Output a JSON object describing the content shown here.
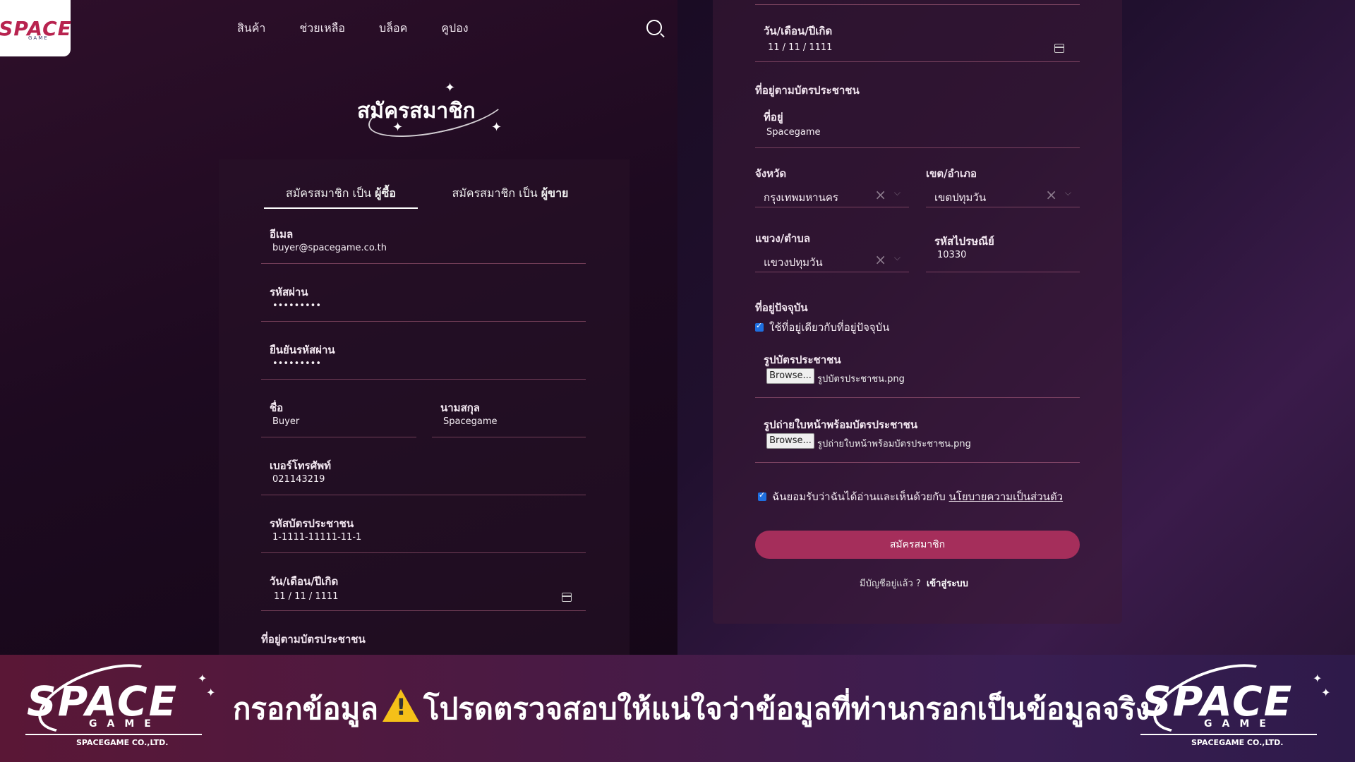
{
  "brand": {
    "logo": "SPACE",
    "logo_sub": "GAME"
  },
  "nav": {
    "items": [
      "สินค้า",
      "ช่วยเหลือ",
      "บล็อค",
      "คูปอง"
    ]
  },
  "page_title": "สมัครสมาชิก",
  "tabs": {
    "buyer_prefix": "สมัครสมาชิก เป็น ",
    "buyer_bold": "ผู้ซื้อ",
    "seller_prefix": "สมัครสมาชิก เป็น ",
    "seller_bold": "ผู้ขาย"
  },
  "left_form": {
    "email_label": "อีเมล",
    "email_value": "buyer@spacegame.co.th",
    "password_label": "รหัสผ่าน",
    "password_value": "•••••••••",
    "confirm_label": "ยืนยันรหัสผ่าน",
    "confirm_value": "•••••••••",
    "firstname_label": "ชื่อ",
    "firstname_value": "Buyer",
    "lastname_label": "นามสกุล",
    "lastname_value": "Spacegame",
    "phone_label": "เบอร์โทรศัพท์",
    "phone_value": "021143219",
    "idcard_label": "รหัสบัตรประชาชน",
    "idcard_value": "1-1111-11111-11-1",
    "dob_label": "วัน/เดือน/ปีเกิด",
    "dob_value": "11 / 11 / 1111",
    "address_section": "ที่อยู่ตามบัตรประชาชน"
  },
  "right_form": {
    "dob_label": "วัน/เดือน/ปีเกิด",
    "dob_value": "11 / 11 / 1111",
    "address_section": "ที่อยู่ตามบัตรประชาชน",
    "address_label": "ที่อยู่",
    "address_value": "Spacegame",
    "province_label": "จังหวัด",
    "province_value": "กรุงเทพมหานคร",
    "district_label": "เขต/อำเภอ",
    "district_value": "เขตปทุมวัน",
    "subdistrict_label": "แขวง/ตำบล",
    "subdistrict_value": "แขวงปทุมวัน",
    "postal_label": "รหัสไปรษณีย์",
    "postal_value": "10330",
    "current_address_section": "ที่อยู่ปัจจุบัน",
    "same_address_label": "ใช้ที่อยู่เดียวกับที่อยู่ปัจจุบัน",
    "idcard_photo_label": "รูปบัตรประชาชน",
    "idcard_photo_file": "รูปบัตรประชาชน.png",
    "selfie_label": "รูปถ่ายใบหน้าพร้อมบัตรประชาชน",
    "selfie_file": "รูปถ่ายใบหน้าพร้อมบัตรประชาชน.png",
    "browse_label": "Browse...",
    "consent_text": "ฉันยอมรับว่าฉันได้อ่านและเห็นด้วยกับ ",
    "consent_link": "นโยบายความเป็นส่วนตัว",
    "submit_label": "สมัครสมาชิก",
    "have_account": "มีบัญชีอยู่แล้ว ?",
    "login_link": "เข้าสู่ระบบ"
  },
  "banner": {
    "logo_text": "SPACE",
    "logo_game": "GAME",
    "logo_company": "SPACEGAME CO.,LTD.",
    "text_part1": "กรอกข้อมูล",
    "text_part2": "โปรดตรวจสอบให้แน่ใจว่าข้อมูลที่ท่านกรอกเป็นข้อมูลจริง"
  },
  "colors": {
    "accent": "#a52e5b",
    "checkbox": "#1e6fe0",
    "warning": "#f5c018"
  }
}
